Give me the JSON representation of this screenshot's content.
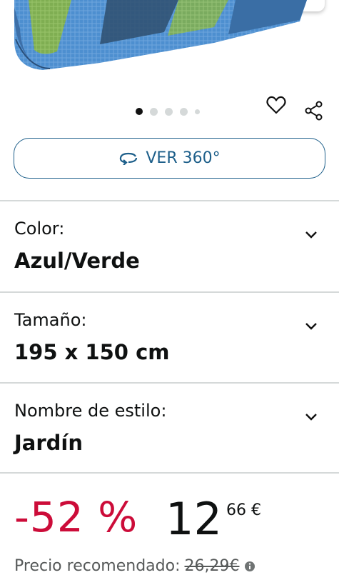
{
  "carousel": {
    "total_slides": 5,
    "active_index": 0
  },
  "actions": {
    "view360_label": "VER 360°"
  },
  "variations": [
    {
      "label": "Color:",
      "value": "Azul/Verde"
    },
    {
      "label": "Tamaño:",
      "value": "195 x 150 cm"
    },
    {
      "label": "Nombre de estilo:",
      "value": "Jardín"
    }
  ],
  "price": {
    "discount": "-52 %",
    "whole": "12",
    "fraction": "66 €",
    "recommended_label": "Precio recomendado:",
    "recommended_value": "26,29€"
  },
  "colors": {
    "accent_blue": "#1d5f8a",
    "discount_red": "#cc0c39",
    "text": "#0f1111",
    "muted": "#565959",
    "divider": "#d5d9d9"
  },
  "icons": [
    "heart-icon",
    "share-icon",
    "rotate-360-icon",
    "chevron-down-icon",
    "info-icon"
  ]
}
